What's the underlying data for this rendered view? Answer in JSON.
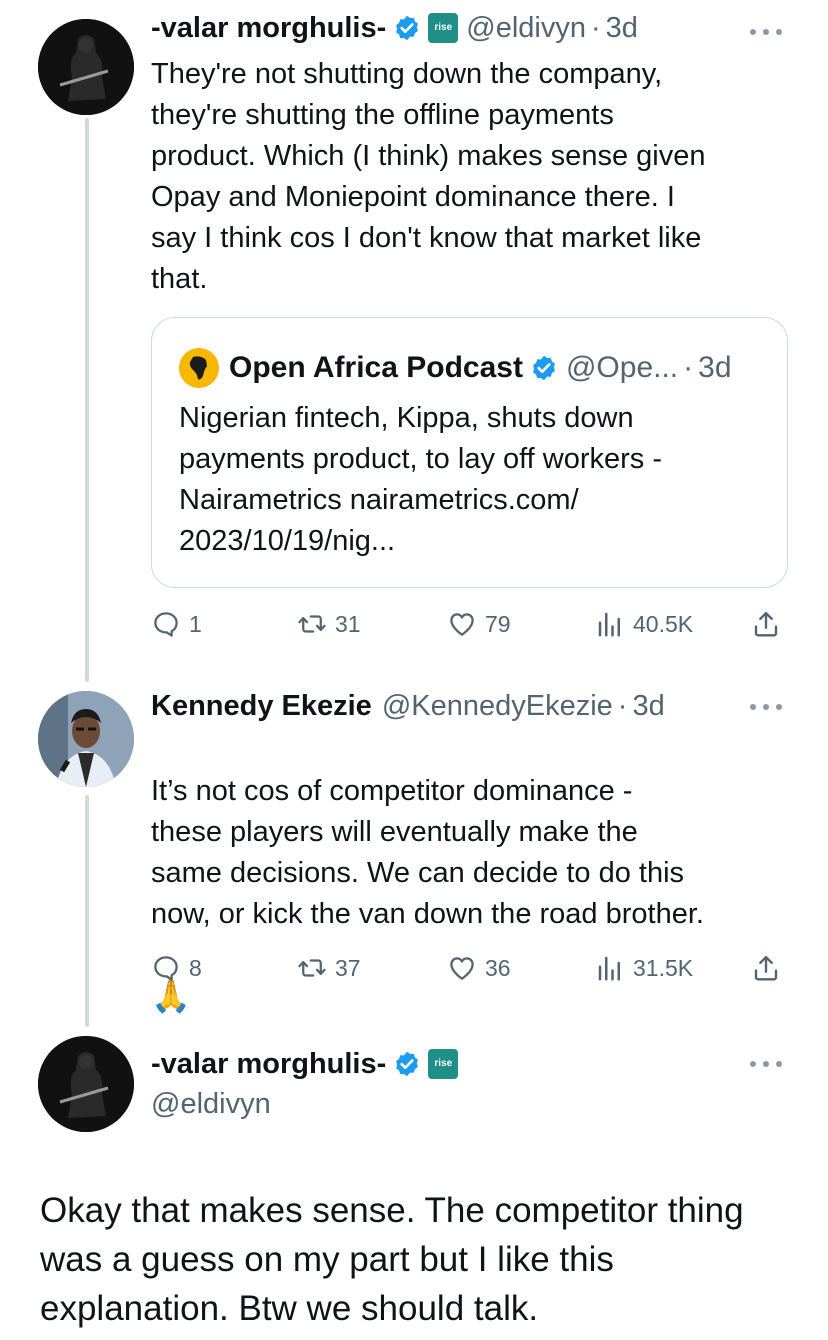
{
  "tweet1": {
    "author_name": "-valar morghulis-",
    "verified": true,
    "affiliate_badge": "rise",
    "handle": "@eldivyn",
    "time": "3d",
    "text": "They're not shutting down the company,\nthey're shutting the offline payments\nproduct. Which (I think) makes sense given\nOpay and Moniepoint dominance there. I\nsay I think cos I don't know that market like\nthat.",
    "quote": {
      "author_name": "Open Africa Podcast",
      "verified": true,
      "handle": "@Ope...",
      "time": "3d",
      "text": "Nigerian fintech, Kippa, shuts down\npayments product, to lay off workers  -\nNairametrics nairametrics.com/\n2023/10/19/nig..."
    },
    "actions": {
      "replies": "1",
      "reposts": "31",
      "likes": "79",
      "views": "40.5K"
    }
  },
  "tweet2": {
    "author_name": "Kennedy Ekezie",
    "handle": "@KennedyEkezie",
    "time": "3d",
    "text": "It’s not cos of competitor dominance -\nthese players will eventually make the\nsame decisions. We can decide to do this\nnow, or kick the van down the road brother.",
    "emoji": "🙏",
    "actions": {
      "replies": "8",
      "reposts": "37",
      "likes": "36",
      "views": "31.5K"
    }
  },
  "tweet3": {
    "author_name": "-valar morghulis-",
    "verified": true,
    "affiliate_badge": "rise",
    "handle": "@eldivyn",
    "text": "Okay that makes sense. The competitor thing\nwas a guess on my part but I like this\nexplanation. Btw we should talk."
  },
  "colors": {
    "verified_blue": "#1d9bf0",
    "affiliate_teal": "#1f8f87",
    "secondary_text": "#536471",
    "thread_line": "#cfd9de"
  },
  "icons": [
    "more-icon",
    "verified-icon",
    "reply-icon",
    "repost-icon",
    "like-icon",
    "views-icon",
    "share-icon"
  ]
}
